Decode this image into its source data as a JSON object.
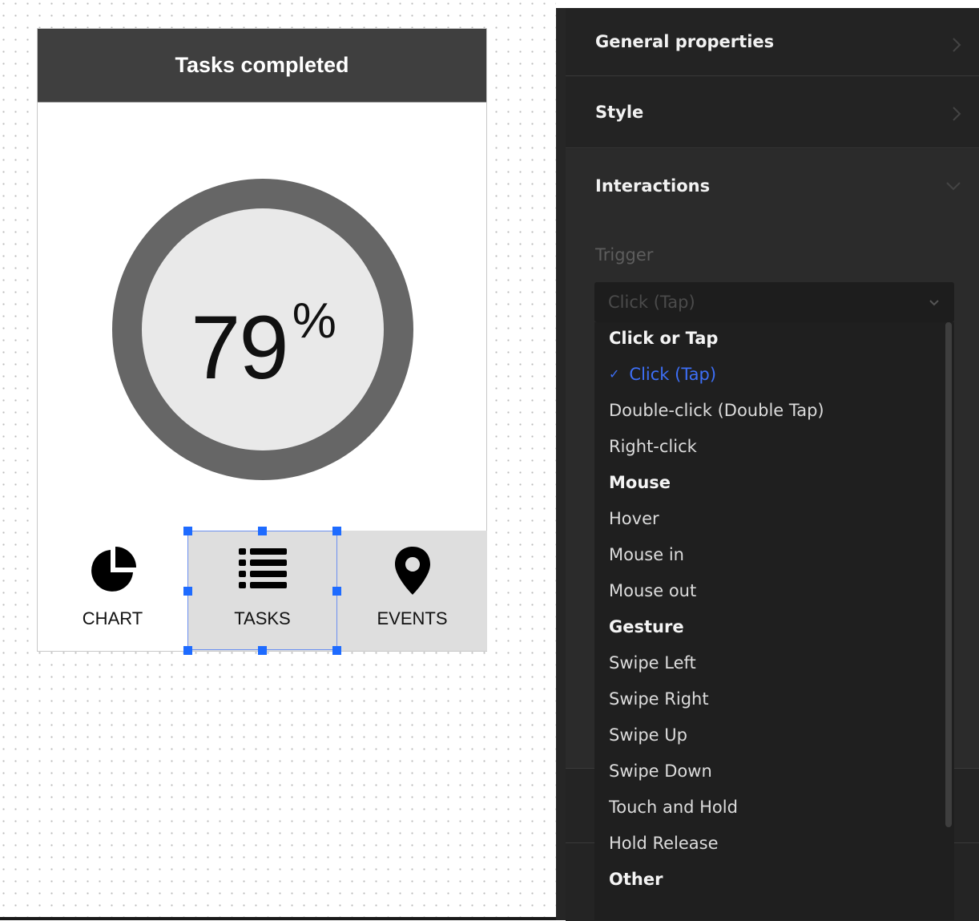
{
  "canvas": {
    "phone": {
      "header_title": "Tasks completed",
      "gauge": {
        "value": "79",
        "unit": "%",
        "fraction": 0.79
      },
      "tabs": [
        {
          "label": "CHART",
          "icon": "pie-chart-icon"
        },
        {
          "label": "TASKS",
          "icon": "list-icon",
          "selected": true
        },
        {
          "label": "EVENTS",
          "icon": "map-pin-icon"
        }
      ]
    },
    "selection_color": "#1e6bff"
  },
  "panel": {
    "sections": {
      "general": {
        "title": "General properties",
        "state": "collapsed"
      },
      "style": {
        "title": "Style",
        "state": "collapsed"
      },
      "interactions": {
        "title": "Interactions",
        "state": "expanded"
      }
    },
    "trigger": {
      "label": "Trigger",
      "selected_value": "Click (Tap)",
      "dropdown": {
        "groups": [
          {
            "header": "Click or Tap",
            "items": [
              "Click (Tap)",
              "Double-click (Double Tap)",
              "Right-click"
            ]
          },
          {
            "header": "Mouse",
            "items": [
              "Hover",
              "Mouse in",
              "Mouse out"
            ]
          },
          {
            "header": "Gesture",
            "items": [
              "Swipe Left",
              "Swipe Right",
              "Swipe Up",
              "Swipe Down",
              "Touch and Hold",
              "Hold Release"
            ]
          },
          {
            "header": "Other",
            "items": []
          }
        ],
        "check_glyph": "✓",
        "accent_color": "#3d6ff7"
      }
    }
  }
}
